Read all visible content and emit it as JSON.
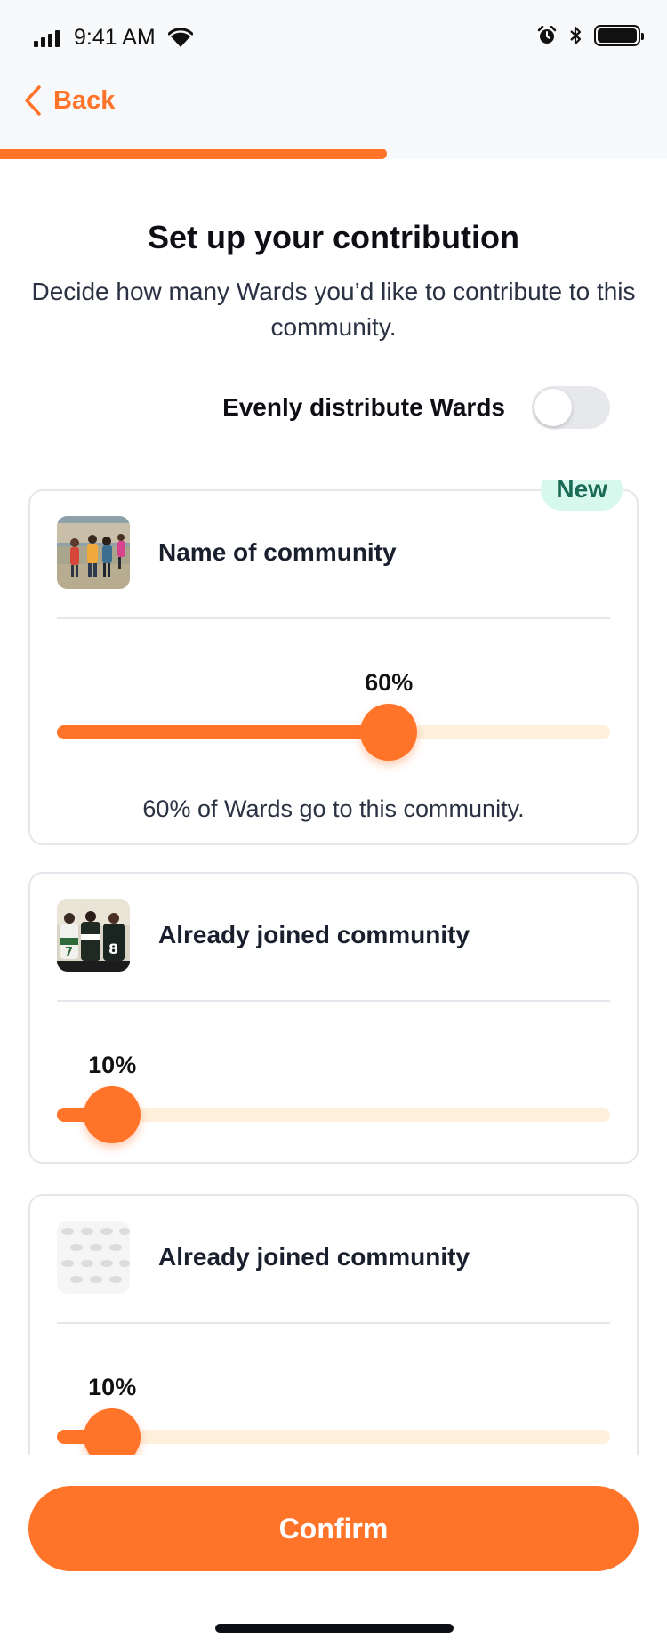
{
  "status_bar": {
    "time": "9:41 AM"
  },
  "nav": {
    "back_label": "Back",
    "progress": 0.58,
    "accent": "#ff7429"
  },
  "header": {
    "title": "Set up your contribution",
    "subtitle": "Decide how many Wards you’d like to contribute to this community."
  },
  "distribute": {
    "label": "Evenly distribute Wards",
    "on": false
  },
  "communities": [
    {
      "name": "Name of community",
      "badge": "New",
      "percent": 60,
      "percent_label": "60%",
      "description": "60% of Wards go to this community.",
      "image": "students-walking-photo"
    },
    {
      "name": "Already joined community",
      "percent": 10,
      "percent_label": "10%",
      "image": "football-team-photo"
    },
    {
      "name": "Already joined community",
      "percent": 10,
      "percent_label": "10%",
      "image": "pattern-placeholder"
    }
  ],
  "confirm_label": "Confirm",
  "colors": {
    "accent": "#ff7429",
    "track": "#fff0dc",
    "badge_bg": "#d7f8ec",
    "badge_text": "#1b6a55"
  }
}
